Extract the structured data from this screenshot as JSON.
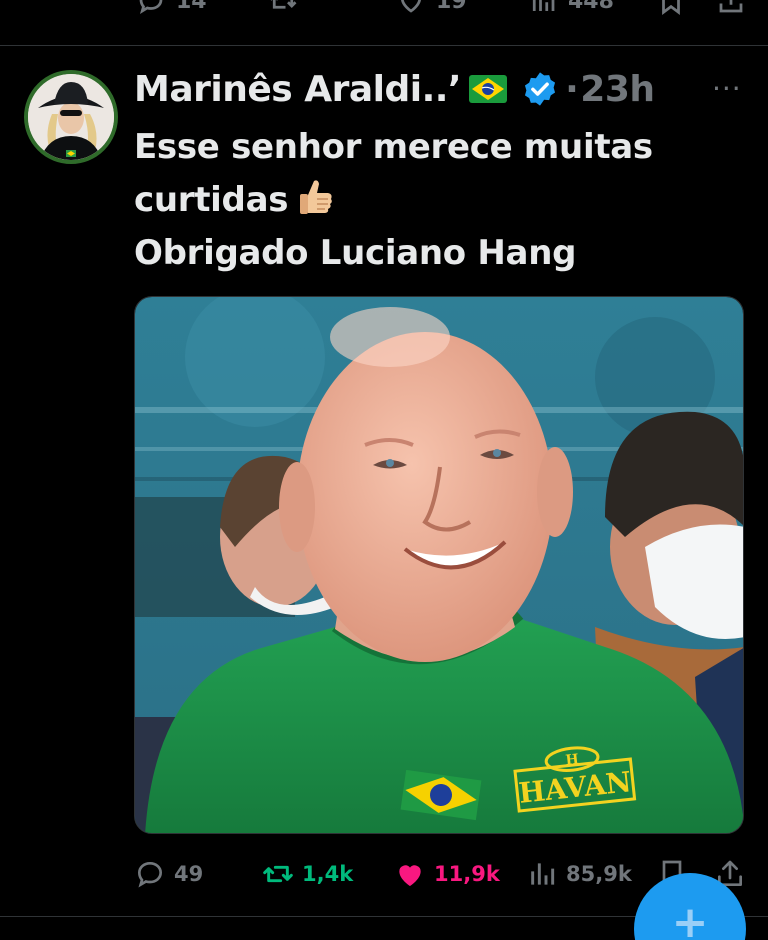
{
  "previous_tweet": {
    "replies": "14",
    "likes": "19",
    "views": "448"
  },
  "tweet": {
    "author_name": "Marinês Araldi..’",
    "time_ago": "23h",
    "separator": "·",
    "more_label": "···",
    "text_lines": [
      "Esse senhor merece muitas",
      "curtidas",
      "Obrigado Luciano Hang"
    ],
    "shirt_logo_text": "HAVAN",
    "shirt_logo_letter": "H"
  },
  "actions": {
    "replies": "49",
    "retweets": "1,4k",
    "likes": "11,9k",
    "views": "85,9k"
  },
  "fab_label": "+",
  "colors": {
    "background": "#000000",
    "text": "#e7e9ea",
    "muted": "#71767b",
    "accent": "#1d9bf0",
    "retweet": "#00ba7c",
    "like": "#f91880",
    "shirt_green": "#1f8f4a"
  },
  "icons": [
    "reply-icon",
    "retweet-icon",
    "like-icon",
    "views-icon",
    "bookmark-icon",
    "share-icon",
    "verified-icon",
    "brazil-flag-icon",
    "thumbs-up-icon",
    "more-icon",
    "compose-icon"
  ]
}
